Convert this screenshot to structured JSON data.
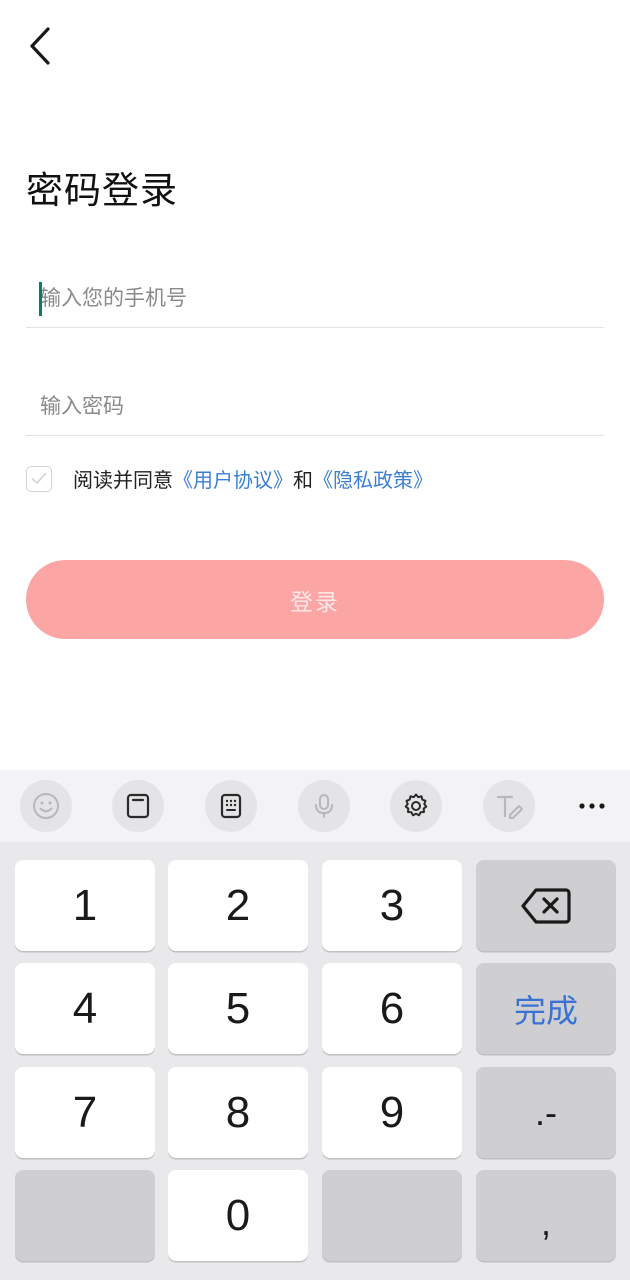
{
  "header": {
    "back_icon": "chevron-left-icon",
    "title": "密码登录"
  },
  "form": {
    "phone_placeholder": "输入您的手机号",
    "phone_value": "",
    "password_placeholder": "输入密码",
    "password_value": ""
  },
  "agreement": {
    "checked": false,
    "prefix": "阅读并同意",
    "user_agreement": "《用户协议》",
    "and": "和",
    "privacy_policy": "《隐私政策》"
  },
  "login_button": "登录",
  "colors": {
    "accent_link": "#3b7fd1",
    "login_disabled": "#fba5a5",
    "caret": "#0a7a6a",
    "done_key": "#3a72d4"
  },
  "keyboard": {
    "toolbar_icons": [
      "emoji-icon",
      "clipboard-icon",
      "keypad-icon",
      "microphone-icon",
      "settings-icon",
      "handwriting-icon",
      "more-icon"
    ],
    "keys": {
      "k1": "1",
      "k2": "2",
      "k3": "3",
      "k4": "4",
      "k5": "5",
      "k6": "6",
      "k7": "7",
      "k8": "8",
      "k9": "9",
      "k0": "0",
      "done": "完成",
      "dot_minus": ".-",
      "comma": ","
    }
  }
}
